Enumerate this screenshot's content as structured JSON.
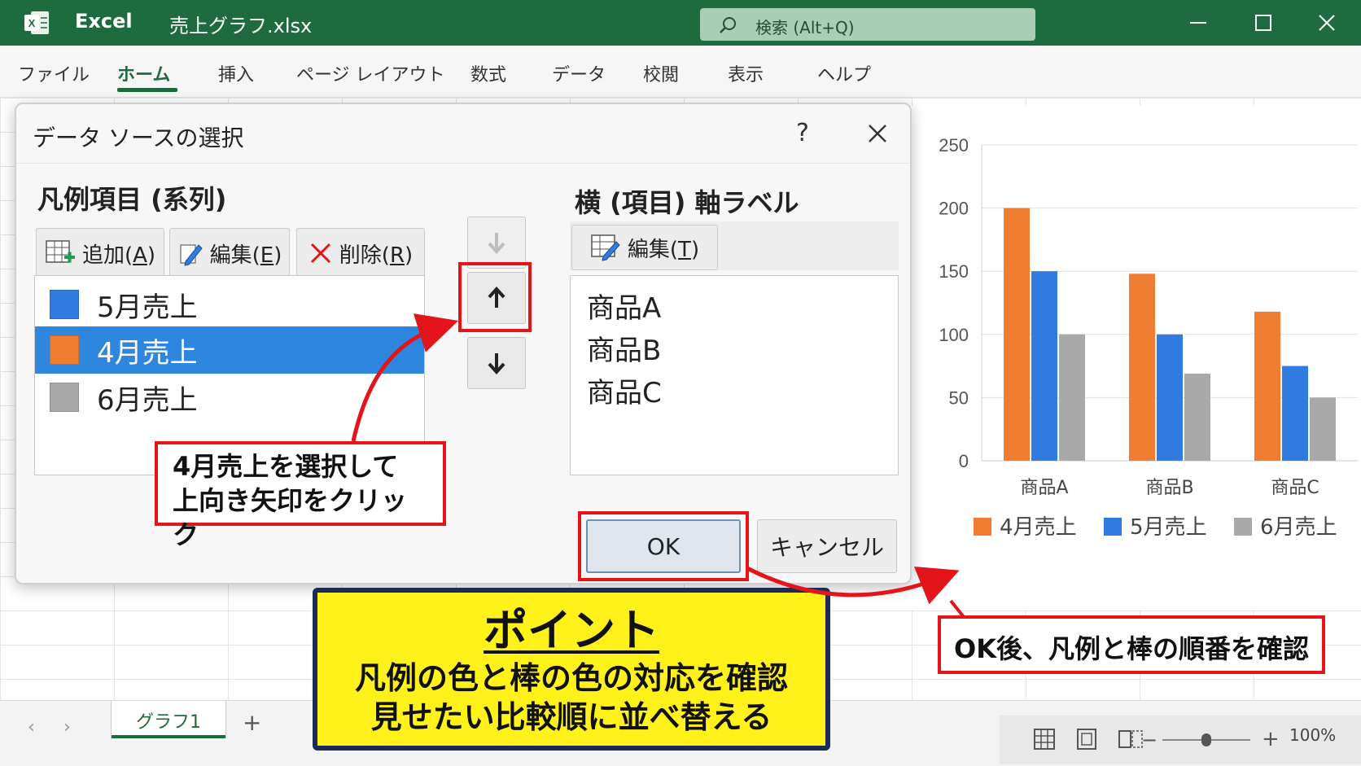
{
  "window": {
    "app_name": "Excel",
    "file_name": "売上グラフ.xlsx",
    "search_placeholder": "検索 (Alt+Q)"
  },
  "ribbon": {
    "tabs": [
      "ファイル",
      "ホーム",
      "挿入",
      "ページ レイアウト",
      "数式",
      "データ",
      "校閲",
      "表示",
      "ヘルプ"
    ],
    "active_tab": "ホーム"
  },
  "dialog": {
    "title": "データ ソースの選択",
    "help": "?",
    "legend_section_label": "凡例項目 (系列)",
    "add_button": {
      "label": "追加(",
      "key": "A",
      "suffix": ")"
    },
    "edit_button": {
      "label": "編集(",
      "key": "E",
      "suffix": ")"
    },
    "delete_button": {
      "label": "削除(",
      "key": "R",
      "suffix": ")"
    },
    "series": [
      {
        "label": "5月売上",
        "color": "#2f7be0",
        "selected": false
      },
      {
        "label": "4月売上",
        "color": "#ef7d32",
        "selected": true
      },
      {
        "label": "6月売上",
        "color": "#a9a9a9",
        "selected": false
      }
    ],
    "axis_section_label": "横 (項目) 軸ラベル",
    "axis_edit_button": {
      "label": "編集(",
      "key": "T",
      "suffix": ")"
    },
    "categories": [
      "商品A",
      "商品B",
      "商品C"
    ],
    "ok_label": "OK",
    "cancel_label": "キャンセル"
  },
  "annotations": {
    "step_callout": [
      "4月売上を選択して",
      "上向き矢印をクリック"
    ],
    "ok_callout": "OK後、凡例と棒の順番を確認",
    "point_title": "ポイント",
    "point_lines": [
      "凡例の色と棒の色の対応を確認",
      "見せたい比較順に並べ替える"
    ],
    "highlight_color": "#e3141a",
    "point_bg": "#fff21b"
  },
  "sheet": {
    "tab_name": "グラフ1",
    "add_sheet": "+",
    "zoom_label": "100%"
  },
  "chart_data": {
    "type": "bar",
    "categories": [
      "商品A",
      "商品B",
      "商品C"
    ],
    "series": [
      {
        "name": "4月売上",
        "color": "#ef7d32",
        "values": [
          200,
          148,
          118
        ]
      },
      {
        "name": "5月売上",
        "color": "#2f7be0",
        "values": [
          150,
          100,
          75
        ]
      },
      {
        "name": "6月売上",
        "color": "#a9a9a9",
        "values": [
          100,
          69,
          50
        ]
      }
    ],
    "ylim": [
      0,
      250
    ],
    "yticks": [
      0,
      50,
      100,
      150,
      200,
      250
    ],
    "grid": true,
    "legend": "bottom"
  }
}
